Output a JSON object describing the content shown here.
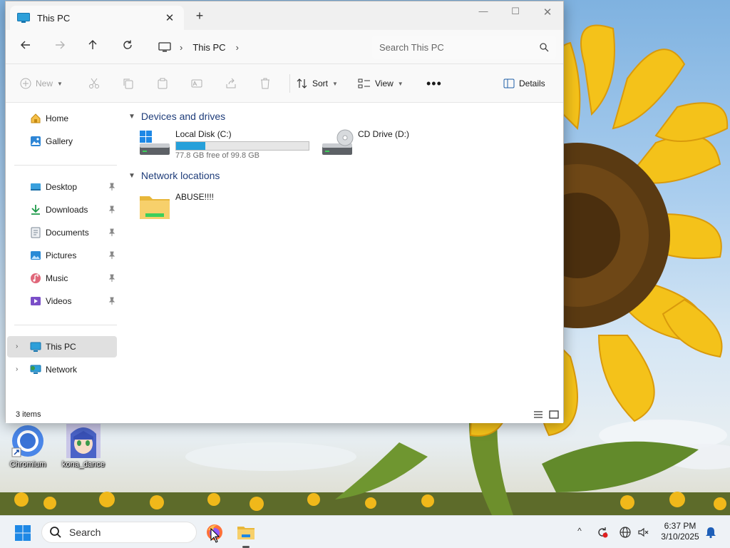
{
  "window": {
    "tab_title": "This PC",
    "new_tab_label": "+",
    "minimize_glyph": "—",
    "maximize_glyph": "☐",
    "close_glyph": "✕",
    "tab_close_glyph": "✕"
  },
  "addressbar": {
    "breadcrumb": [
      "This PC"
    ],
    "search_placeholder": "Search This PC"
  },
  "toolbar": {
    "new_label": "New",
    "sort_label": "Sort",
    "view_label": "View",
    "more_label": "•••",
    "details_label": "Details"
  },
  "sidebar": {
    "quick": [
      {
        "label": "Home",
        "icon": "home-icon"
      },
      {
        "label": "Gallery",
        "icon": "gallery-icon"
      }
    ],
    "pinned": [
      {
        "label": "Desktop",
        "icon": "desktop-folder-icon"
      },
      {
        "label": "Downloads",
        "icon": "downloads-icon"
      },
      {
        "label": "Documents",
        "icon": "documents-icon"
      },
      {
        "label": "Pictures",
        "icon": "pictures-icon"
      },
      {
        "label": "Music",
        "icon": "music-icon"
      },
      {
        "label": "Videos",
        "icon": "videos-icon"
      }
    ],
    "tree": [
      {
        "label": "This PC",
        "icon": "this-pc-icon",
        "selected": true
      },
      {
        "label": "Network",
        "icon": "network-icon",
        "selected": false
      }
    ]
  },
  "content": {
    "groups": [
      {
        "title": "Devices and drives"
      },
      {
        "title": "Network locations"
      }
    ],
    "drives": [
      {
        "name": "Local Disk (C:)",
        "free_text": "77.8 GB free of 99.8 GB",
        "used_fraction": 0.22
      },
      {
        "name": "CD Drive (D:)"
      }
    ],
    "network_locations": [
      {
        "name": "ABUSE!!!!"
      }
    ]
  },
  "statusbar": {
    "item_count": "3 items"
  },
  "desktop": {
    "icons": [
      {
        "label": "Chromium"
      },
      {
        "label": "kona_dance"
      }
    ]
  },
  "taskbar": {
    "search_label": "Search",
    "time": "6:37 PM",
    "date": "3/10/2025",
    "tray_overflow_glyph": "^"
  },
  "colors": {
    "accent": "#26a0da",
    "group_header": "#1f3d7a",
    "selected_bg": "#e0e0e0"
  }
}
